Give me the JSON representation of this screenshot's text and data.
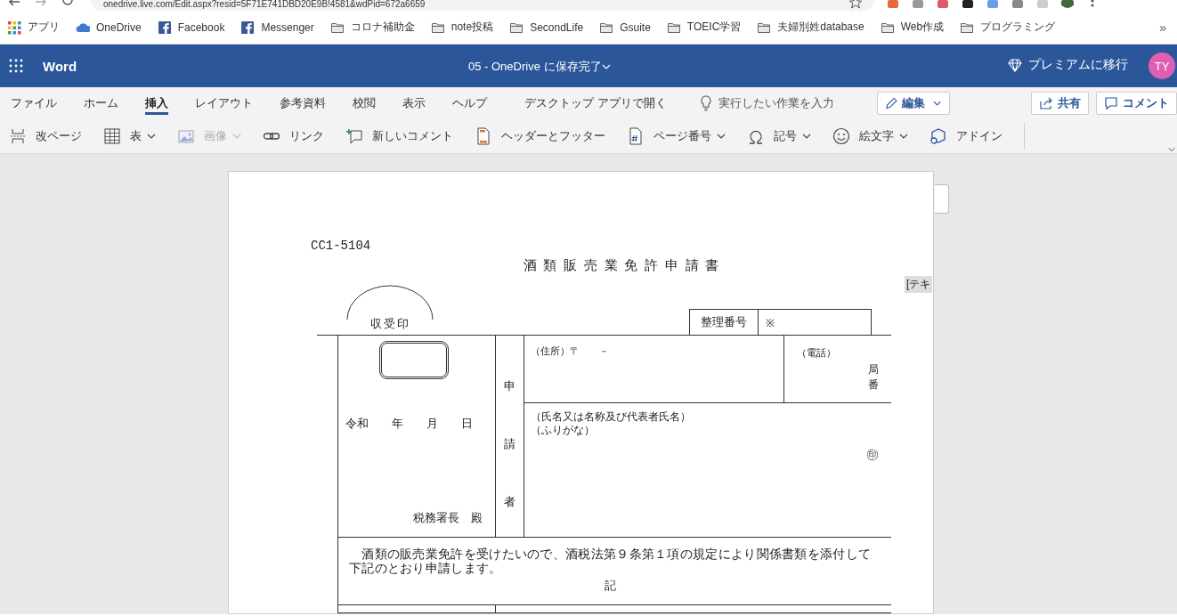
{
  "browser": {
    "url": "onedrive.live.com/Edit.aspx?resid=5F71E741DBD20E9B!4581&wdPid=672a6659",
    "bookmarks": [
      {
        "label": "アプリ",
        "kind": "apps"
      },
      {
        "label": "OneDrive",
        "kind": "cloud"
      },
      {
        "label": "Facebook",
        "kind": "social"
      },
      {
        "label": "Messenger",
        "kind": "social"
      },
      {
        "label": "コロナ補助金",
        "kind": "folder"
      },
      {
        "label": "note投稿",
        "kind": "folder"
      },
      {
        "label": "SecondLife",
        "kind": "folder"
      },
      {
        "label": "Gsuite",
        "kind": "folder"
      },
      {
        "label": "TOEIC学習",
        "kind": "folder"
      },
      {
        "label": "夫婦別姓database",
        "kind": "folder"
      },
      {
        "label": "Web作成",
        "kind": "folder"
      },
      {
        "label": "プログラミング",
        "kind": "folder"
      }
    ],
    "more": "»"
  },
  "app": {
    "name": "Word",
    "doc_title": "05 - OneDrive に保存完了",
    "premium": "プレミアムに移行",
    "avatar": "TY"
  },
  "ribbon_tabs": [
    {
      "label": "ファイル",
      "selected": false
    },
    {
      "label": "ホーム",
      "selected": false
    },
    {
      "label": "挿入",
      "selected": true
    },
    {
      "label": "レイアウト",
      "selected": false
    },
    {
      "label": "参考資料",
      "selected": false
    },
    {
      "label": "校閲",
      "selected": false
    },
    {
      "label": "表示",
      "selected": false
    },
    {
      "label": "ヘルプ",
      "selected": false
    }
  ],
  "ribbon_right": {
    "open_desktop": "デスクトップ アプリで開く",
    "search_placeholder": "実行したい作業を入力",
    "mode": "編集",
    "share": "共有",
    "comment": "コメント"
  },
  "commands": [
    {
      "label": "改ページ",
      "kind": "pagebreak",
      "dropdown": false,
      "disabled": false
    },
    {
      "label": "表",
      "kind": "table",
      "dropdown": true,
      "disabled": false
    },
    {
      "label": "画像",
      "kind": "image",
      "dropdown": true,
      "disabled": true
    },
    {
      "label": "リンク",
      "kind": "link",
      "dropdown": false,
      "disabled": false
    },
    {
      "label": "新しいコメント",
      "kind": "comment",
      "dropdown": false,
      "disabled": false
    },
    {
      "label": "ヘッダーとフッター",
      "kind": "header",
      "dropdown": false,
      "disabled": false
    },
    {
      "label": "ページ番号",
      "kind": "pagenum",
      "dropdown": true,
      "disabled": false
    },
    {
      "label": "記号",
      "kind": "symbol",
      "dropdown": true,
      "disabled": false
    },
    {
      "label": "絵文字",
      "kind": "emoji",
      "dropdown": true,
      "disabled": false
    },
    {
      "label": "アドイン",
      "kind": "addin",
      "dropdown": false,
      "disabled": false
    }
  ],
  "document": {
    "code": "CC1-5104",
    "title": "酒 類 販 売 業 免 許 申 請 書",
    "stamp_label": "収受印",
    "ref_label": "整理番号",
    "ref_mark": "※",
    "address_label": "（住所）〒　　－",
    "phone_label": "（電話）",
    "phone_units": [
      "局",
      "番"
    ],
    "date": "令和　　年　　月　　日",
    "addressee": "税務署長　殿",
    "applicant_label": [
      "申",
      "請",
      "者"
    ],
    "name_label": "（氏名又は名称及び代表者氏名）",
    "furigana_label": "（ふりがな）",
    "seal": "㊞",
    "statement": "　酒類の販売業免許を受けたいので、酒税法第９条第１項の規定により関係書類を添付して下記のとおり申請します。",
    "record": "記"
  },
  "side_tag": "[テキ"
}
